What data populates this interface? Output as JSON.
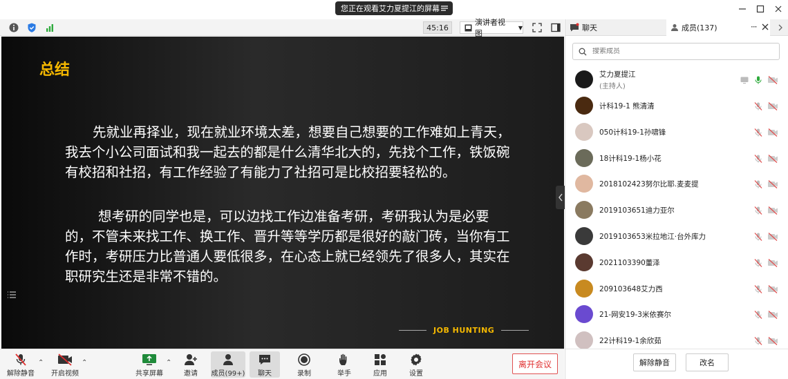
{
  "window": {
    "share_banner": "您正在观看艾力夏提江的屏幕"
  },
  "toolbar": {
    "timer": "45:16",
    "view_mode": "演讲者视图"
  },
  "slide": {
    "title": "总结",
    "para1": "先就业再择业，现在就业环境太差，想要自己想要的工作难如上青天，我去个小公司面试和我一起去的都是什么清华北大的，先找个工作，铁饭碗有校招和社招，有工作经验了有能力了社招可是比校招要轻松的。",
    "para2": "想考研的同学也是，可以边找工作边准备考研，考研我认为是必要的，不管未来找工作、换工作、晋升等等学历都是很好的敲门砖，当你有工作时，考研压力比普通人要低很多，在心态上就已经领先了很多人，其实在职研究生还是非常不错的。",
    "tagline": "JOB HUNTING"
  },
  "bottombar": {
    "unmute": "解除静音",
    "start_video": "开启视频",
    "share_screen": "共享屏幕",
    "invite": "邀请",
    "members": "成员(99+)",
    "chat": "聊天",
    "record": "录制",
    "raise_hand": "举手",
    "apps": "应用",
    "settings": "设置",
    "leave": "离开会议"
  },
  "panel": {
    "tab_chat": "聊天",
    "tab_members": "成员(137)",
    "search_placeholder": "搜索成员",
    "host_role": "(主持人)",
    "members": [
      {
        "name": "艾力夏提江",
        "color": "#1a1a1a"
      },
      {
        "name": "计科19-1 熊清清",
        "color": "#4a2a10"
      },
      {
        "name": "050计科19-1孙啸锋",
        "color": "#d9c8c0"
      },
      {
        "name": "18计科19-1杨小花",
        "color": "#6b6b5a"
      },
      {
        "name": "2018102423努尔比耶.麦麦提",
        "color": "#e0b8a0"
      },
      {
        "name": "2019103651迪力亚尔",
        "color": "#8a7a60"
      },
      {
        "name": "2019103653米拉地江·台外库力",
        "color": "#3a3a3a"
      },
      {
        "name": "2021103390董泽",
        "color": "#5a3a30"
      },
      {
        "name": "209103648艾力西",
        "color": "#c88a20"
      },
      {
        "name": "21-网安19-3米依赛尔",
        "color": "#6a4ad0"
      },
      {
        "name": "22计科19-1余欣茹",
        "color": "#d0c0c0"
      }
    ],
    "mute_all": "解除静音",
    "rename": "改名"
  }
}
